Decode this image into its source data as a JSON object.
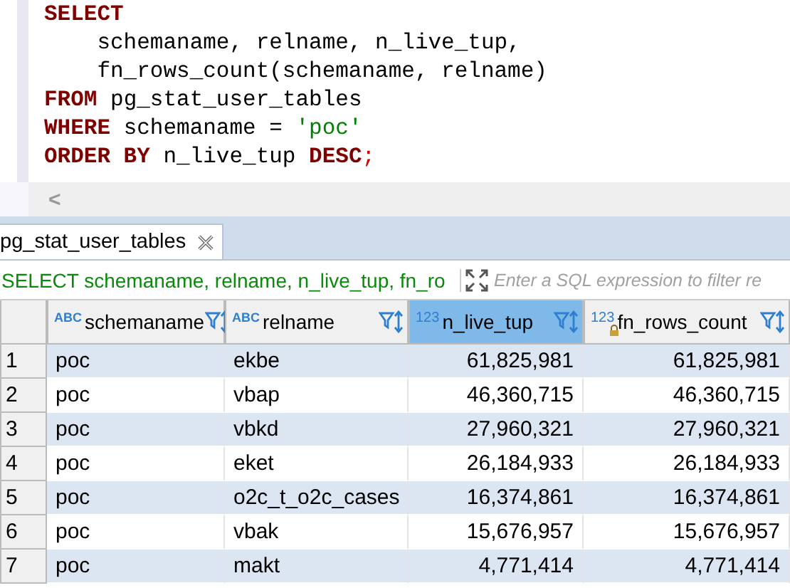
{
  "editor": {
    "lines": [
      [
        {
          "kind": "keyword",
          "text": "SELECT"
        }
      ],
      [
        {
          "kind": "plain",
          "text": "    schemaname, relname, n_live_tup,"
        }
      ],
      [
        {
          "kind": "plain",
          "text": "    fn_rows_count(schemaname, relname)"
        }
      ],
      [
        {
          "kind": "keyword",
          "text": "FROM"
        },
        {
          "kind": "plain",
          "text": " pg_stat_user_tables"
        }
      ],
      [
        {
          "kind": "keyword",
          "text": "WHERE"
        },
        {
          "kind": "plain",
          "text": " schemaname = "
        },
        {
          "kind": "string",
          "text": "'poc'"
        }
      ],
      [
        {
          "kind": "keyword",
          "text": "ORDER BY"
        },
        {
          "kind": "plain",
          "text": " n_live_tup "
        },
        {
          "kind": "keyword",
          "text": "DESC"
        },
        {
          "kind": "punct",
          "text": ";"
        }
      ]
    ]
  },
  "scrollbar": {
    "arrow": "<"
  },
  "tabs": [
    {
      "label": "pg_stat_user_tables",
      "selected": true
    }
  ],
  "filter": {
    "query": "SELECT schemaname, relname, n_live_tup, fn_ro",
    "placeholder": "Enter a SQL expression to filter re"
  },
  "table": {
    "columns": [
      {
        "kind": "text",
        "type_label": "ABC",
        "name": "schemaname",
        "selected": false,
        "locked": false
      },
      {
        "kind": "text",
        "type_label": "ABC",
        "name": "relname",
        "selected": false,
        "locked": false
      },
      {
        "kind": "number",
        "type_label": "123",
        "name": "n_live_tup",
        "selected": true,
        "locked": false
      },
      {
        "kind": "number",
        "type_label": "123",
        "name": "fn_rows_count",
        "selected": false,
        "locked": true
      }
    ],
    "rows": [
      {
        "num": "1",
        "cells": [
          "poc",
          "ekbe",
          "61,825,981",
          "61,825,981"
        ]
      },
      {
        "num": "2",
        "cells": [
          "poc",
          "vbap",
          "46,360,715",
          "46,360,715"
        ]
      },
      {
        "num": "3",
        "cells": [
          "poc",
          "vbkd",
          "27,960,321",
          "27,960,321"
        ]
      },
      {
        "num": "4",
        "cells": [
          "poc",
          "eket",
          "26,184,933",
          "26,184,933"
        ]
      },
      {
        "num": "5",
        "cells": [
          "poc",
          "o2c_t_o2c_cases",
          "16,374,861",
          "16,374,861"
        ]
      },
      {
        "num": "6",
        "cells": [
          "poc",
          "vbak",
          "15,676,957",
          "15,676,957"
        ]
      },
      {
        "num": "7",
        "cells": [
          "poc",
          "makt",
          "4,771,414",
          "4,771,414"
        ]
      }
    ]
  }
}
